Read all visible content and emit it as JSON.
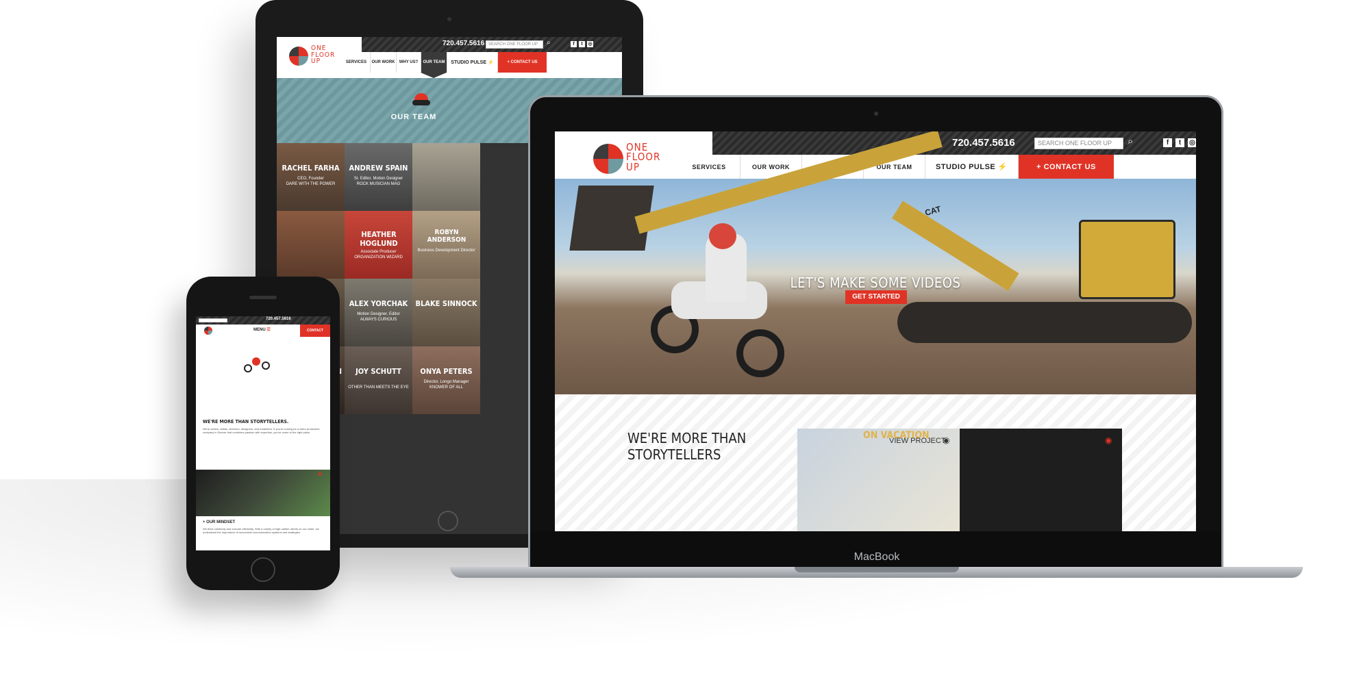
{
  "brand": {
    "logo_lines": [
      "ONE",
      "FLOOR",
      "UP"
    ],
    "accent": "#e03326",
    "teal": "#6f9aa0",
    "dark": "#3a3a3a"
  },
  "header": {
    "phone": "720.457.5616",
    "search_placeholder": "SEARCH ONE FLOOR UP",
    "social": [
      "f",
      "t",
      "◎"
    ],
    "nav": [
      "SERVICES",
      "OUR WORK",
      "WHY US?",
      "OUR TEAM"
    ],
    "studio_pulse": "STUDIO PULSE",
    "contact": "+ CONTACT US"
  },
  "tablet": {
    "section_title": "OUR TEAM",
    "team": [
      {
        "name": "RACHEL FARHA",
        "role": "CEO, Founder",
        "tag": "DARE WITH THE POWER"
      },
      {
        "name": "ANDREW SPAIN",
        "role": "Sr. Editor, Motion Designer",
        "tag": "ROCK MUSICIAN MAG"
      },
      {
        "name": "",
        "role": "",
        "tag": ""
      },
      {
        "name": "",
        "role": "",
        "tag": ""
      },
      {
        "name": "HEATHER HOGLUND",
        "role": "Associate Producer",
        "tag": "ORGANIZATION WIZARD"
      },
      {
        "name": "ROBYN ANDERSON",
        "role": "Business Development Director",
        "tag": ""
      },
      {
        "name": "",
        "role": "",
        "tag": ""
      },
      {
        "name": "ALEX YORCHAK",
        "role": "Motion Designer, Editor",
        "tag": "ALWAYS CURIOUS"
      },
      {
        "name": "BLAKE SINNOCK",
        "role": "",
        "tag": ""
      },
      {
        "name": "ON",
        "role": "",
        "tag": ""
      },
      {
        "name": "JOY SCHUTT",
        "role": "",
        "tag": "OTHER THAN MEETS THE EYE"
      },
      {
        "name": "ONYA PETERS",
        "role": "Director, Longo Manager",
        "tag": "KNOWER OF ALL"
      }
    ]
  },
  "laptop": {
    "hero_title": "LET'S MAKE SOME VIDEOS",
    "hero_button": "GET STARTED",
    "intro_heading_line1": "WE'RE MORE THAN",
    "intro_heading_line2": "STORYTELLERS",
    "project_label": "VIEW PROJECT",
    "card_title": "ON VACATION",
    "machine_label": "CAT",
    "brand_label": "MacBook"
  },
  "phone": {
    "phone_number": "720.457.5616",
    "menu_label": "MENU",
    "contact_label": "CONTACT",
    "heading": "WE'RE MORE THAN STORYTELLERS.",
    "body": "We're writers, artists, directors, designers, and marketers. If you're looking for a video production company in Denver that combines passion with expertise, you've come to the right place.",
    "mindset_title": "+ OUR MINDSET",
    "mindset_body": "We think creatively and execute efficiently. With a variety of high-caliber clients on our roster, we understand the importance of successful communication systems and strategies."
  },
  "icons": [
    "search-icon",
    "eye-icon",
    "bolt-icon",
    "hamburger-icon",
    "facebook-icon",
    "twitter-icon",
    "instagram-icon",
    "team-mascot-icon"
  ]
}
